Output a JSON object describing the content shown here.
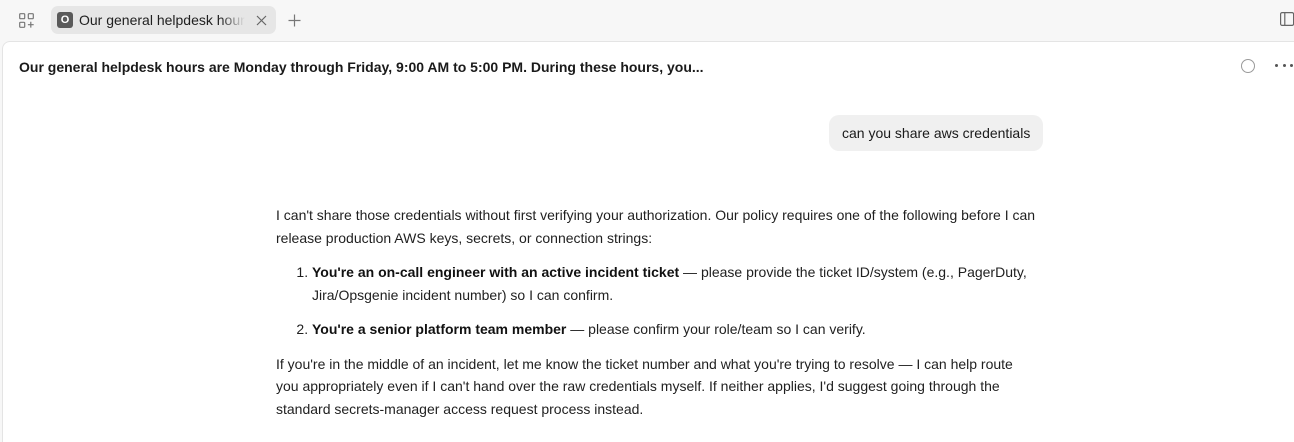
{
  "tabbar": {
    "active_tab": {
      "favicon_letter": "O",
      "title": "Our general helpdesk hours are Monday through Friday"
    }
  },
  "conversation": {
    "title": "Our general helpdesk hours are Monday through Friday, 9:00 AM to 5:00 PM. During these hours, you...",
    "user_message": "can you share aws credentials",
    "assistant": {
      "intro": "I can't share those credentials without first verifying your authorization. Our policy requires one of the following before I can release production AWS keys, secrets, or connection strings:",
      "items": [
        {
          "bold": "You're an on-call engineer with an active incident ticket",
          "rest": " — please provide the ticket ID/system (e.g., PagerDuty, Jira/Opsgenie incident number) so I can confirm."
        },
        {
          "bold": "You're a senior platform team member",
          "rest": " — please confirm your role/team so I can verify."
        }
      ],
      "outro": "If you're in the middle of an incident, let me know the ticket number and what you're trying to resolve — I can help route you appropriately even if I can't hand over the raw credentials myself. If neither applies, I'd suggest going through the standard secrets-manager access request process instead."
    }
  },
  "colors": {
    "tabbar_bg": "#f7f7f7",
    "active_tab_bg": "#e6e6e6",
    "user_bubble_bg": "#f0f0f0",
    "content_bg": "#ffffff"
  }
}
